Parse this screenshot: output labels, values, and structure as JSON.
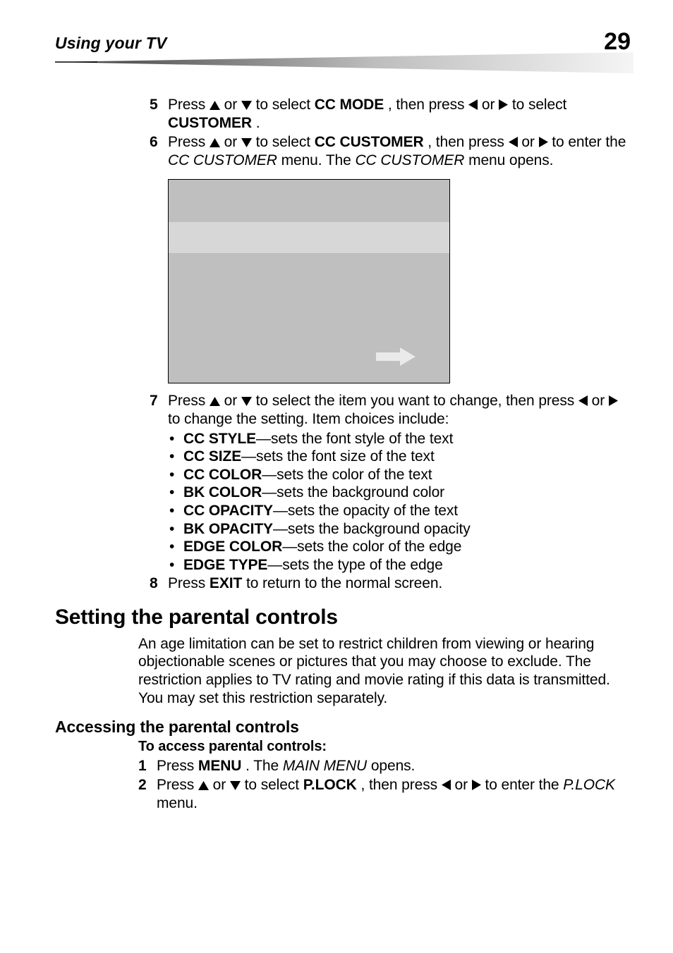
{
  "header": {
    "title": "Using your TV",
    "page_number": "29"
  },
  "steps": {
    "s5": {
      "num": "5",
      "t1": "Press ",
      "t2": " or ",
      "t3": " to select ",
      "b1": "CC MODE",
      "t4": ", then press ",
      "t5": " or ",
      "t6": " to select ",
      "b2": "CUSTOMER",
      "t7": "."
    },
    "s6": {
      "num": "6",
      "t1": "Press ",
      "t2": " or ",
      "t3": " to select ",
      "b1": "CC CUSTOMER",
      "t4": ", then press ",
      "t5": " or ",
      "t6": " to enter the ",
      "i1": "CC CUSTOMER",
      "t7": " menu. The ",
      "i2": "CC CUSTOMER",
      "t8": " menu opens."
    },
    "s7": {
      "num": "7",
      "t1": "Press ",
      "t2": " or ",
      "t3": " to select the item you want to change, then press ",
      "t4": " or ",
      "t5": " to change the setting. Item choices include:"
    },
    "s8": {
      "num": "8",
      "t1": "Press ",
      "b1": "EXIT",
      "t2": " to return to the normal screen."
    }
  },
  "choices": [
    {
      "b": "CC STYLE",
      "t": "—sets the font style of the text"
    },
    {
      "b": "CC SIZE",
      "t": "—sets the font size of the text"
    },
    {
      "b": "CC COLOR",
      "t": "—sets the color of the text"
    },
    {
      "b": "BK COLOR",
      "t": "—sets the background color"
    },
    {
      "b": "CC OPACITY",
      "t": "—sets the opacity of the text"
    },
    {
      "b": "BK OPACITY",
      "t": "—sets the background opacity"
    },
    {
      "b": "EDGE COLOR",
      "t": "—sets the color of the edge"
    },
    {
      "b": "EDGE TYPE",
      "t": "—sets the type of the edge"
    }
  ],
  "section": {
    "heading": "Setting the parental controls",
    "body": "An age limitation can be set to restrict children from viewing or hearing objectionable scenes or pictures that you may choose to exclude. The restriction applies to TV rating and movie rating if this data is transmitted. You may set this restriction separately."
  },
  "subsection": {
    "heading": "Accessing the parental controls",
    "proc_title": "To access parental controls:",
    "s1": {
      "num": "1",
      "t1": "Press ",
      "b1": "MENU",
      "t2": ". The ",
      "i1": "MAIN MENU",
      "t3": " opens."
    },
    "s2": {
      "num": "2",
      "t1": "Press ",
      "t2": " or ",
      "t3": " to select ",
      "b1": "P.LOCK",
      "t4": ", then press ",
      "t5": " or ",
      "t6": " to enter the ",
      "i1": "P.LOCK",
      "t7": " menu."
    }
  }
}
